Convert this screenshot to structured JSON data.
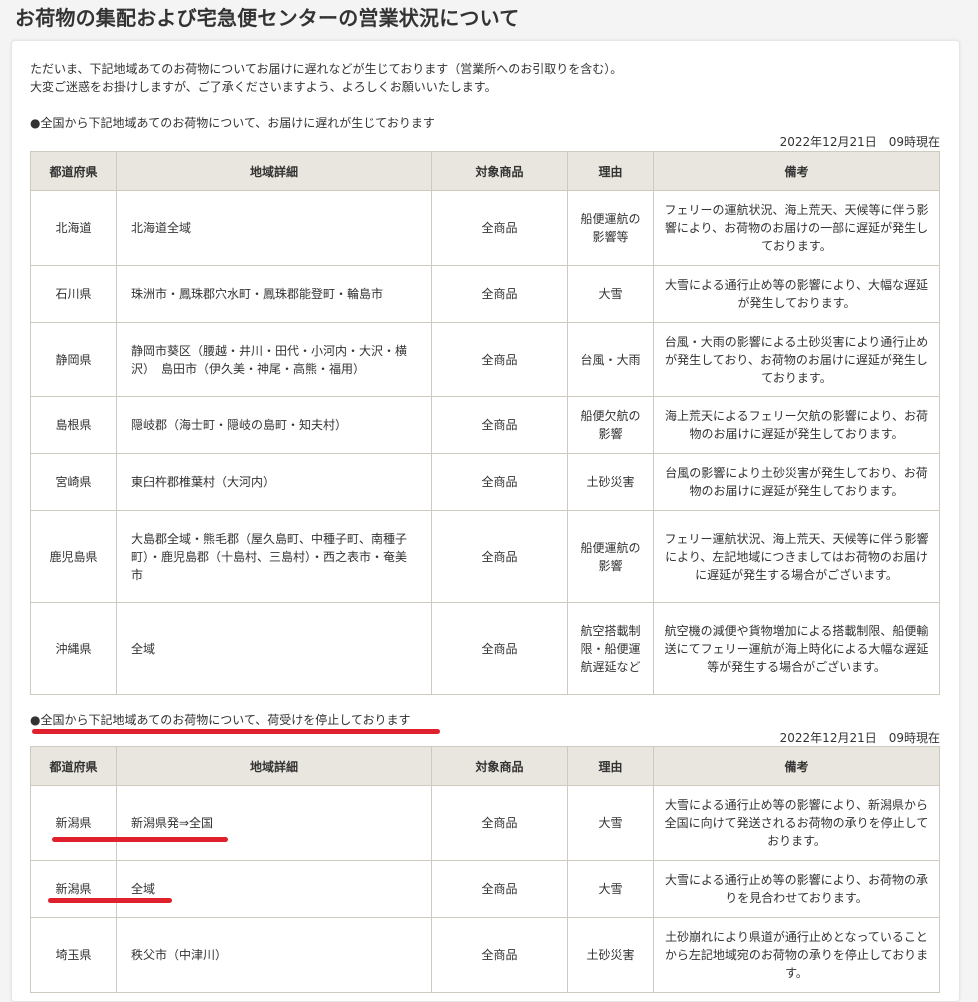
{
  "page": {
    "title": "お荷物の集配および宅急便センターの営業状況について",
    "intro_line1": "ただいま、下記地域あてのお荷物についてお届けに遅れなどが生じております（営業所へのお引取りを含む）。",
    "intro_line2": "大変ご迷惑をお掛けしますが、ご了承くださいますよう、よろしくお願いいたします。"
  },
  "headers": {
    "pref": "都道府県",
    "area": "地域詳細",
    "product": "対象商品",
    "reason": "理由",
    "note": "備考"
  },
  "section1": {
    "heading": "●全国から下記地域あてのお荷物について、お届けに遅れが生じております",
    "as_of": "2022年12月21日　09時現在",
    "rows": [
      {
        "pref": "北海道",
        "area": "北海道全域",
        "product": "全商品",
        "reason": "船便運航の影響等",
        "note": "フェリーの運航状況、海上荒天、天候等に伴う影響により、お荷物のお届けの一部に遅延が発生しております。"
      },
      {
        "pref": "石川県",
        "area": "珠洲市・鳳珠郡穴水町・鳳珠郡能登町・輪島市",
        "product": "全商品",
        "reason": "大雪",
        "note": "大雪による通行止め等の影響により、大幅な遅延が発生しております。"
      },
      {
        "pref": "静岡県",
        "area": "静岡市葵区（腰越・井川・田代・小河内・大沢・横沢）　島田市（伊久美・神尾・高熊・福用）",
        "product": "全商品",
        "reason": "台風・大雨",
        "note": "台風・大雨の影響による土砂災害により通行止めが発生しており、お荷物のお届けに遅延が発生しております。"
      },
      {
        "pref": "島根県",
        "area": "隠岐郡（海士町・隠岐の島町・知夫村）",
        "product": "全商品",
        "reason": "船便欠航の影響",
        "note": "海上荒天によるフェリー欠航の影響により、お荷物のお届けに遅延が発生しております。"
      },
      {
        "pref": "宮崎県",
        "area": "東臼杵郡椎葉村（大河内）",
        "product": "全商品",
        "reason": "土砂災害",
        "note": "台風の影響により土砂災害が発生しており、お荷物のお届けに遅延が発生しております。"
      },
      {
        "pref": "鹿児島県",
        "area": "大島郡全域・熊毛郡（屋久島町、中種子町、南種子町）・鹿児島郡（十島村、三島村）・西之表市・奄美市",
        "product": "全商品",
        "reason": "船便運航の影響",
        "note": "フェリー運航状況、海上荒天、天候等に伴う影響により、左記地域につきましてはお荷物のお届けに遅延が発生する場合がございます。"
      },
      {
        "pref": "沖縄県",
        "area": "全域",
        "product": "全商品",
        "reason": "航空搭載制限・船便運航遅延など",
        "note": "航空機の減便や貨物増加による搭載制限、船便輸送にてフェリー運航が海上時化による大幅な遅延等が発生する場合がございます。"
      }
    ]
  },
  "section2": {
    "heading": "●全国から下記地域あてのお荷物について、荷受けを停止しております",
    "as_of": "2022年12月21日　09時現在",
    "rows": [
      {
        "pref": "新潟県",
        "area": "新潟県発⇒全国",
        "product": "全商品",
        "reason": "大雪",
        "note": "大雪による通行止め等の影響により、新潟県から全国に向けて発送されるお荷物の承りを停止しております。"
      },
      {
        "pref": "新潟県",
        "area": "全域",
        "product": "全商品",
        "reason": "大雪",
        "note": "大雪による通行止め等の影響により、お荷物の承りを見合わせております。"
      },
      {
        "pref": "埼玉県",
        "area": "秩父市（中津川）",
        "product": "全商品",
        "reason": "土砂災害",
        "note": "土砂崩れにより県道が通行止めとなっていることから左記地域宛のお荷物の承りを停止しております。"
      }
    ]
  },
  "colors": {
    "header_bg": "#e9e6df",
    "border": "#cfcac0",
    "highlight": "#e0202c"
  }
}
